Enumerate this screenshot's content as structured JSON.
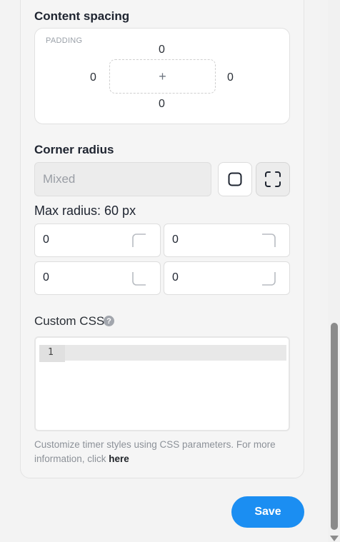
{
  "content_spacing": {
    "title": "Content spacing",
    "padding_label": "PADDING",
    "top": "0",
    "left": "0",
    "right": "0",
    "bottom": "0",
    "center_symbol": "+"
  },
  "corner_radius": {
    "title": "Corner radius",
    "input_value": "Mixed",
    "uniform_icon": "square-icon",
    "individual_icon": "corners-icon",
    "max_radius": "Max radius: 60 px",
    "corners": {
      "top_left": "0",
      "top_right": "0",
      "bottom_left": "0",
      "bottom_right": "0"
    }
  },
  "custom_css": {
    "label": "Custom CSS",
    "help_symbol": "?",
    "line_number": "1",
    "help_text": "Customize timer styles using CSS parameters. For more information, click ",
    "help_link": "here"
  },
  "footer": {
    "save_label": "Save"
  },
  "colors": {
    "accent": "#1b8ef2",
    "panel": "#f5f5f5"
  }
}
